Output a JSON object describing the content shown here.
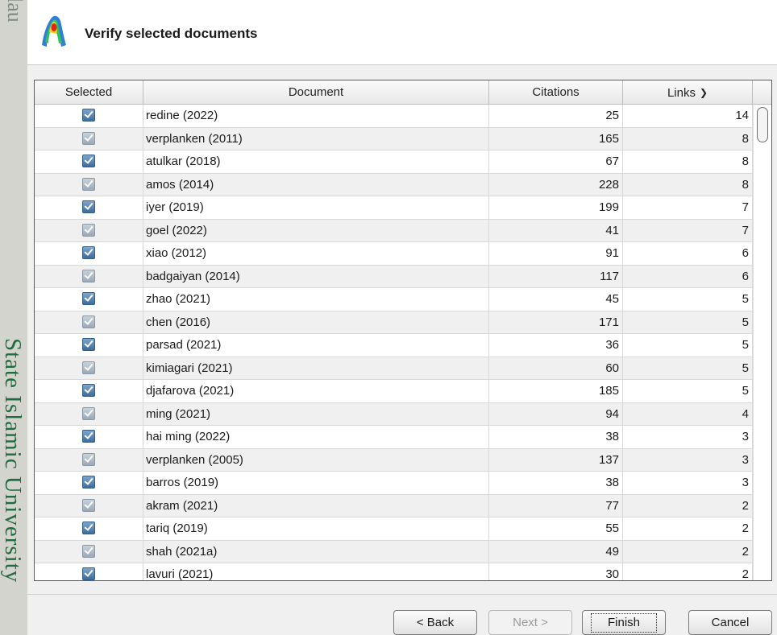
{
  "background": {
    "top_text": "lau",
    "side_text": "State Islamic University"
  },
  "header": {
    "title": "Verify selected documents"
  },
  "table": {
    "columns": [
      "Selected",
      "Document",
      "Citations",
      "Links"
    ],
    "sort_column": "Links",
    "rows": [
      {
        "selected": true,
        "document": "redine (2022)",
        "citations": "25",
        "links": "14"
      },
      {
        "selected": true,
        "document": "verplanken (2011)",
        "citations": "165",
        "links": "8"
      },
      {
        "selected": true,
        "document": "atulkar (2018)",
        "citations": "67",
        "links": "8"
      },
      {
        "selected": true,
        "document": "amos (2014)",
        "citations": "228",
        "links": "8"
      },
      {
        "selected": true,
        "document": "iyer (2019)",
        "citations": "199",
        "links": "7"
      },
      {
        "selected": true,
        "document": "goel (2022)",
        "citations": "41",
        "links": "7"
      },
      {
        "selected": true,
        "document": "xiao (2012)",
        "citations": "91",
        "links": "6"
      },
      {
        "selected": true,
        "document": "badgaiyan (2014)",
        "citations": "117",
        "links": "6"
      },
      {
        "selected": true,
        "document": "zhao (2021)",
        "citations": "45",
        "links": "5"
      },
      {
        "selected": true,
        "document": "chen (2016)",
        "citations": "171",
        "links": "5"
      },
      {
        "selected": true,
        "document": "parsad (2021)",
        "citations": "36",
        "links": "5"
      },
      {
        "selected": true,
        "document": "kimiagari (2021)",
        "citations": "60",
        "links": "5"
      },
      {
        "selected": true,
        "document": "djafarova (2021)",
        "citations": "185",
        "links": "5"
      },
      {
        "selected": true,
        "document": "ming (2021)",
        "citations": "94",
        "links": "4"
      },
      {
        "selected": true,
        "document": "hai ming (2022)",
        "citations": "38",
        "links": "3"
      },
      {
        "selected": true,
        "document": "verplanken (2005)",
        "citations": "137",
        "links": "3"
      },
      {
        "selected": true,
        "document": "barros (2019)",
        "citations": "38",
        "links": "3"
      },
      {
        "selected": true,
        "document": "akram (2021)",
        "citations": "77",
        "links": "2"
      },
      {
        "selected": true,
        "document": "tariq (2019)",
        "citations": "55",
        "links": "2"
      },
      {
        "selected": true,
        "document": "shah (2021a)",
        "citations": "49",
        "links": "2"
      },
      {
        "selected": true,
        "document": "lavuri (2021)",
        "citations": "30",
        "links": "2"
      }
    ]
  },
  "footer": {
    "back_label": "< Back",
    "next_label": "Next >",
    "finish_label": "Finish",
    "cancel_label": "Cancel"
  },
  "colors": {
    "checkbox": "#3d6d9c",
    "side_text": "#1f6c3f"
  }
}
